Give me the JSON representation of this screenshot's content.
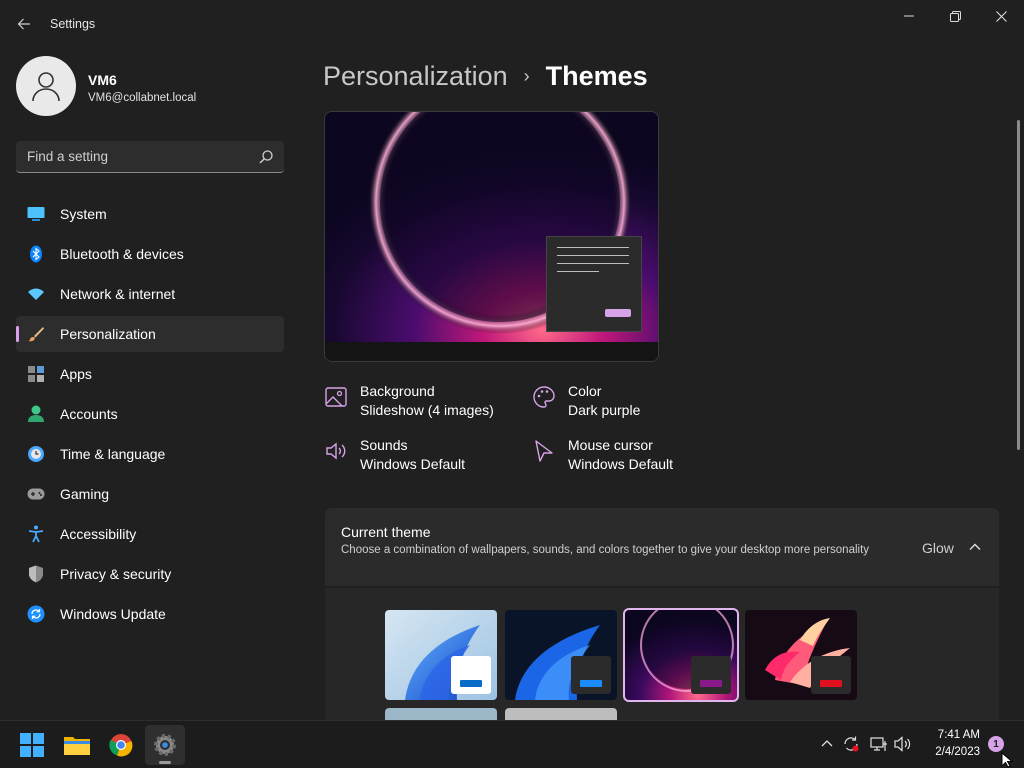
{
  "window": {
    "title": "Settings",
    "back_icon": "back-arrow-icon",
    "controls": [
      "minimize-icon",
      "maximize-icon",
      "close-icon"
    ]
  },
  "user": {
    "name": "VM6",
    "email": "VM6@collabnet.local"
  },
  "search": {
    "placeholder": "Find a setting"
  },
  "sidebar": {
    "items": [
      {
        "label": "System",
        "icon": "system-icon",
        "color": "#4cc2ff"
      },
      {
        "label": "Bluetooth & devices",
        "icon": "bluetooth-icon",
        "color": "#0a84ff"
      },
      {
        "label": "Network & internet",
        "icon": "wifi-icon",
        "color": "#5cc8ff"
      },
      {
        "label": "Personalization",
        "icon": "brush-icon",
        "active": true
      },
      {
        "label": "Apps",
        "icon": "apps-icon"
      },
      {
        "label": "Accounts",
        "icon": "accounts-icon",
        "color": "#3fc68a"
      },
      {
        "label": "Time & language",
        "icon": "time-language-icon"
      },
      {
        "label": "Gaming",
        "icon": "gaming-icon"
      },
      {
        "label": "Accessibility",
        "icon": "accessibility-icon",
        "color": "#4aa8ff"
      },
      {
        "label": "Privacy & security",
        "icon": "shield-icon"
      },
      {
        "label": "Windows Update",
        "icon": "update-icon",
        "color": "#1e90ff"
      }
    ]
  },
  "breadcrumb": {
    "parent": "Personalization",
    "separator": "›",
    "current": "Themes"
  },
  "properties": {
    "background": {
      "title": "Background",
      "value": "Slideshow (4 images)"
    },
    "color": {
      "title": "Color",
      "value": "Dark purple"
    },
    "sounds": {
      "title": "Sounds",
      "value": "Windows Default"
    },
    "mouse_cursor": {
      "title": "Mouse cursor",
      "value": "Windows Default"
    }
  },
  "current_theme": {
    "title": "Current theme",
    "description": "Choose a combination of wallpapers, sounds, and colors together to give your desktop more personality",
    "value": "Glow"
  },
  "themes": [
    {
      "name": "windows-light",
      "selected": false
    },
    {
      "name": "windows-dark",
      "selected": false
    },
    {
      "name": "glow",
      "selected": true
    },
    {
      "name": "captured-motion",
      "selected": false
    }
  ],
  "colors": {
    "accent": "#d7a3e8",
    "background": "#202020",
    "card": "#2b2b2b"
  },
  "taskbar": {
    "apps": [
      "start-icon",
      "file-explorer-icon",
      "chrome-icon",
      "settings-icon"
    ],
    "tray": [
      "chevron-up-icon",
      "sync-icon",
      "network-icon",
      "volume-icon"
    ],
    "time": "7:41 AM",
    "date": "2/4/2023",
    "notifications": "1"
  }
}
